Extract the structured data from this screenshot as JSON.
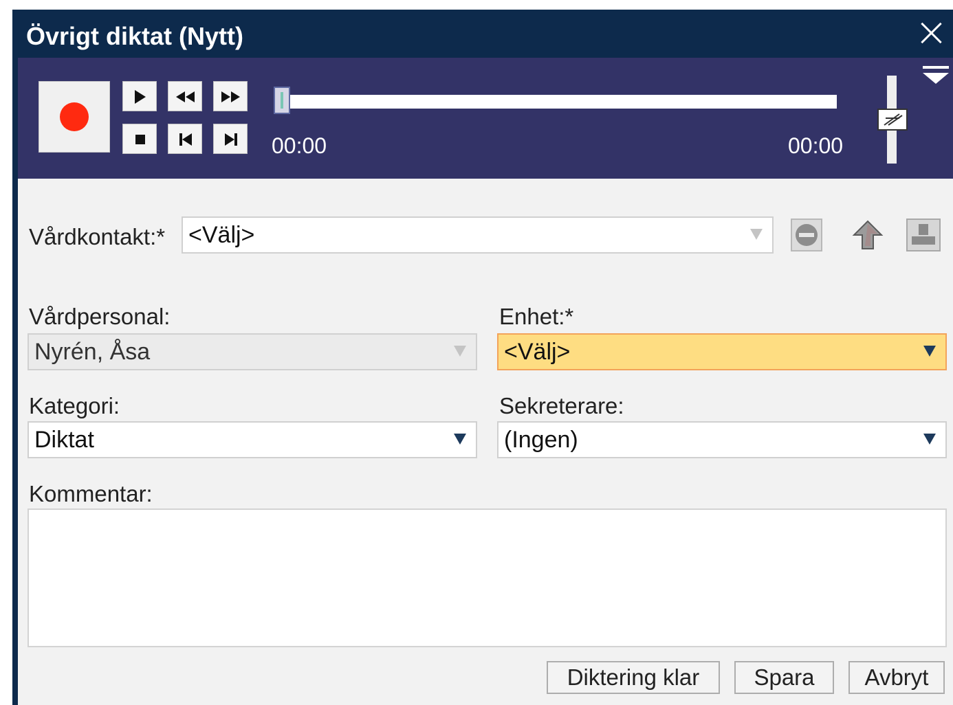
{
  "window": {
    "title": "Övrigt diktat (Nytt)"
  },
  "player": {
    "time_start": "00:00",
    "time_end": "00:00"
  },
  "form": {
    "vardkontakt": {
      "label": "Vårdkontakt:*",
      "value": "<Välj>"
    },
    "vardpersonal": {
      "label": "Vårdpersonal:",
      "value": "Nyrén, Åsa"
    },
    "enhet": {
      "label": "Enhet:*",
      "value": "<Välj>"
    },
    "kategori": {
      "label": "Kategori:",
      "value": "Diktat"
    },
    "sekreterare": {
      "label": "Sekreterare:",
      "value": "(Ingen)"
    },
    "kommentar": {
      "label": "Kommentar:",
      "value": ""
    }
  },
  "buttons": {
    "diktering_klar": "Diktering klar",
    "spara": "Spara",
    "avbryt": "Avbryt"
  },
  "icons": {
    "close": "close-icon",
    "record": "record-icon",
    "play": "play-icon",
    "rewind": "rewind-icon",
    "fast_forward": "fast-forward-icon",
    "stop": "stop-icon",
    "skip_start": "skip-to-start-icon",
    "skip_end": "skip-to-end-icon",
    "menu": "dropdown-menu-icon",
    "remove": "remove-icon",
    "upload": "upload-icon",
    "patient": "patient-icon"
  },
  "colors": {
    "titlebar": "#0d2a4c",
    "player": "#333367",
    "record": "#ff2a10",
    "highlight_field": "#fedd82"
  }
}
